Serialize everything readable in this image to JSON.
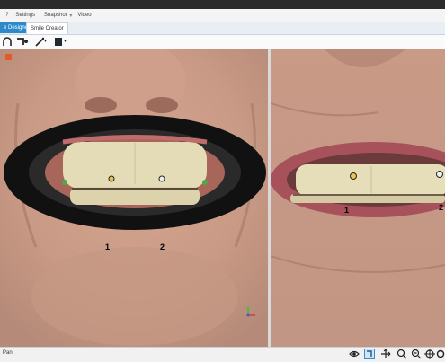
{
  "menu": {
    "items": [
      "?",
      "Settings",
      "Snapshot",
      "Video"
    ],
    "dropdown_glyph": "▾"
  },
  "tabs": [
    {
      "label": "e Designer",
      "active": true
    },
    {
      "label": "Smile Creator",
      "active": false
    }
  ],
  "toolbar": {
    "icons": [
      "arc-tool-icon",
      "transform-tool-icon",
      "pen-tool-icon",
      "swatch-icon"
    ],
    "dropdown_glyph": "▾"
  },
  "viewports": {
    "left": {
      "markers": [
        {
          "label": "1"
        },
        {
          "label": "2"
        }
      ]
    },
    "right": {
      "markers": [
        {
          "label": "1"
        },
        {
          "label": "2"
        }
      ]
    }
  },
  "status": {
    "text": "Pan"
  },
  "status_icons": [
    "eye-icon",
    "ruler-icon",
    "move-icon",
    "zoom-in-icon",
    "zoom-out-icon",
    "crosshair-icon",
    "settings-icon"
  ],
  "colors": {
    "accent": "#2d8ac9",
    "top_bar": "#2b2b2b",
    "retractor": "#111111"
  }
}
